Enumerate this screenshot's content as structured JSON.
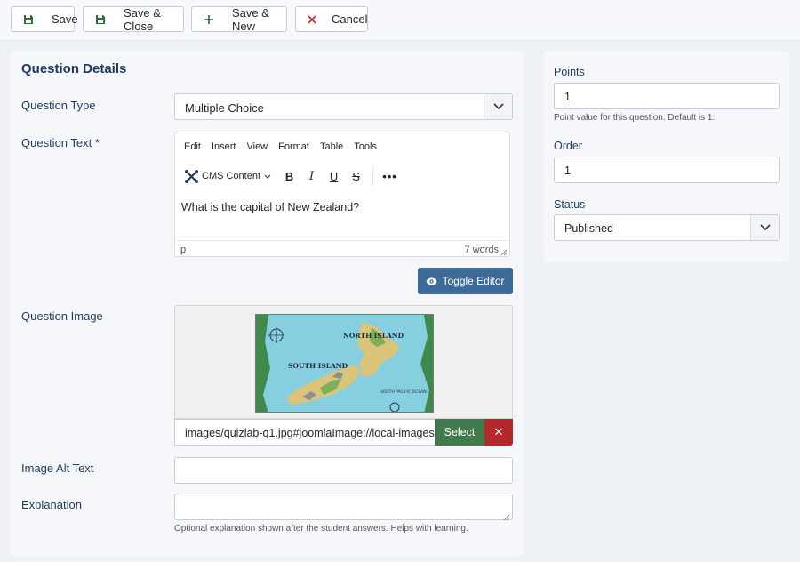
{
  "toolbar": {
    "save_label": "Save",
    "save_close_label": "Save & Close",
    "save_new_label": "Save & New",
    "cancel_label": "Cancel"
  },
  "main": {
    "section_title": "Question Details",
    "question_type": {
      "label": "Question Type",
      "value": "Multiple Choice"
    },
    "question_text": {
      "label": "Question Text *",
      "menu": [
        "Edit",
        "Insert",
        "View",
        "Format",
        "Table",
        "Tools"
      ],
      "block_label": "CMS Content",
      "content": "What is the capital of New Zealand?",
      "path": "p",
      "word_count": "7 words"
    },
    "toggle_editor_label": "Toggle Editor",
    "question_image": {
      "label": "Question Image",
      "path": "images/quizlab-q1.jpg#joomlaImage://local-images/",
      "select_label": "Select",
      "clear_label": "✕",
      "map_north": "NORTH ISLAND",
      "map_south": "SOUTH ISLAND",
      "map_ocean": "SOUTH PACIFIC OCEAN"
    },
    "image_alt": {
      "label": "Image Alt Text",
      "value": ""
    },
    "explanation": {
      "label": "Explanation",
      "value": "",
      "help": "Optional explanation shown after the student answers. Helps with learning."
    }
  },
  "side": {
    "points": {
      "label": "Points",
      "value": "1",
      "help": "Point value for this question. Default is 1."
    },
    "order": {
      "label": "Order",
      "value": "1"
    },
    "status": {
      "label": "Status",
      "value": "Published"
    }
  },
  "colors": {
    "primary": "#3d6a97",
    "success": "#417a4b",
    "danger": "#b2282b",
    "heading": "#1f3a5f"
  }
}
